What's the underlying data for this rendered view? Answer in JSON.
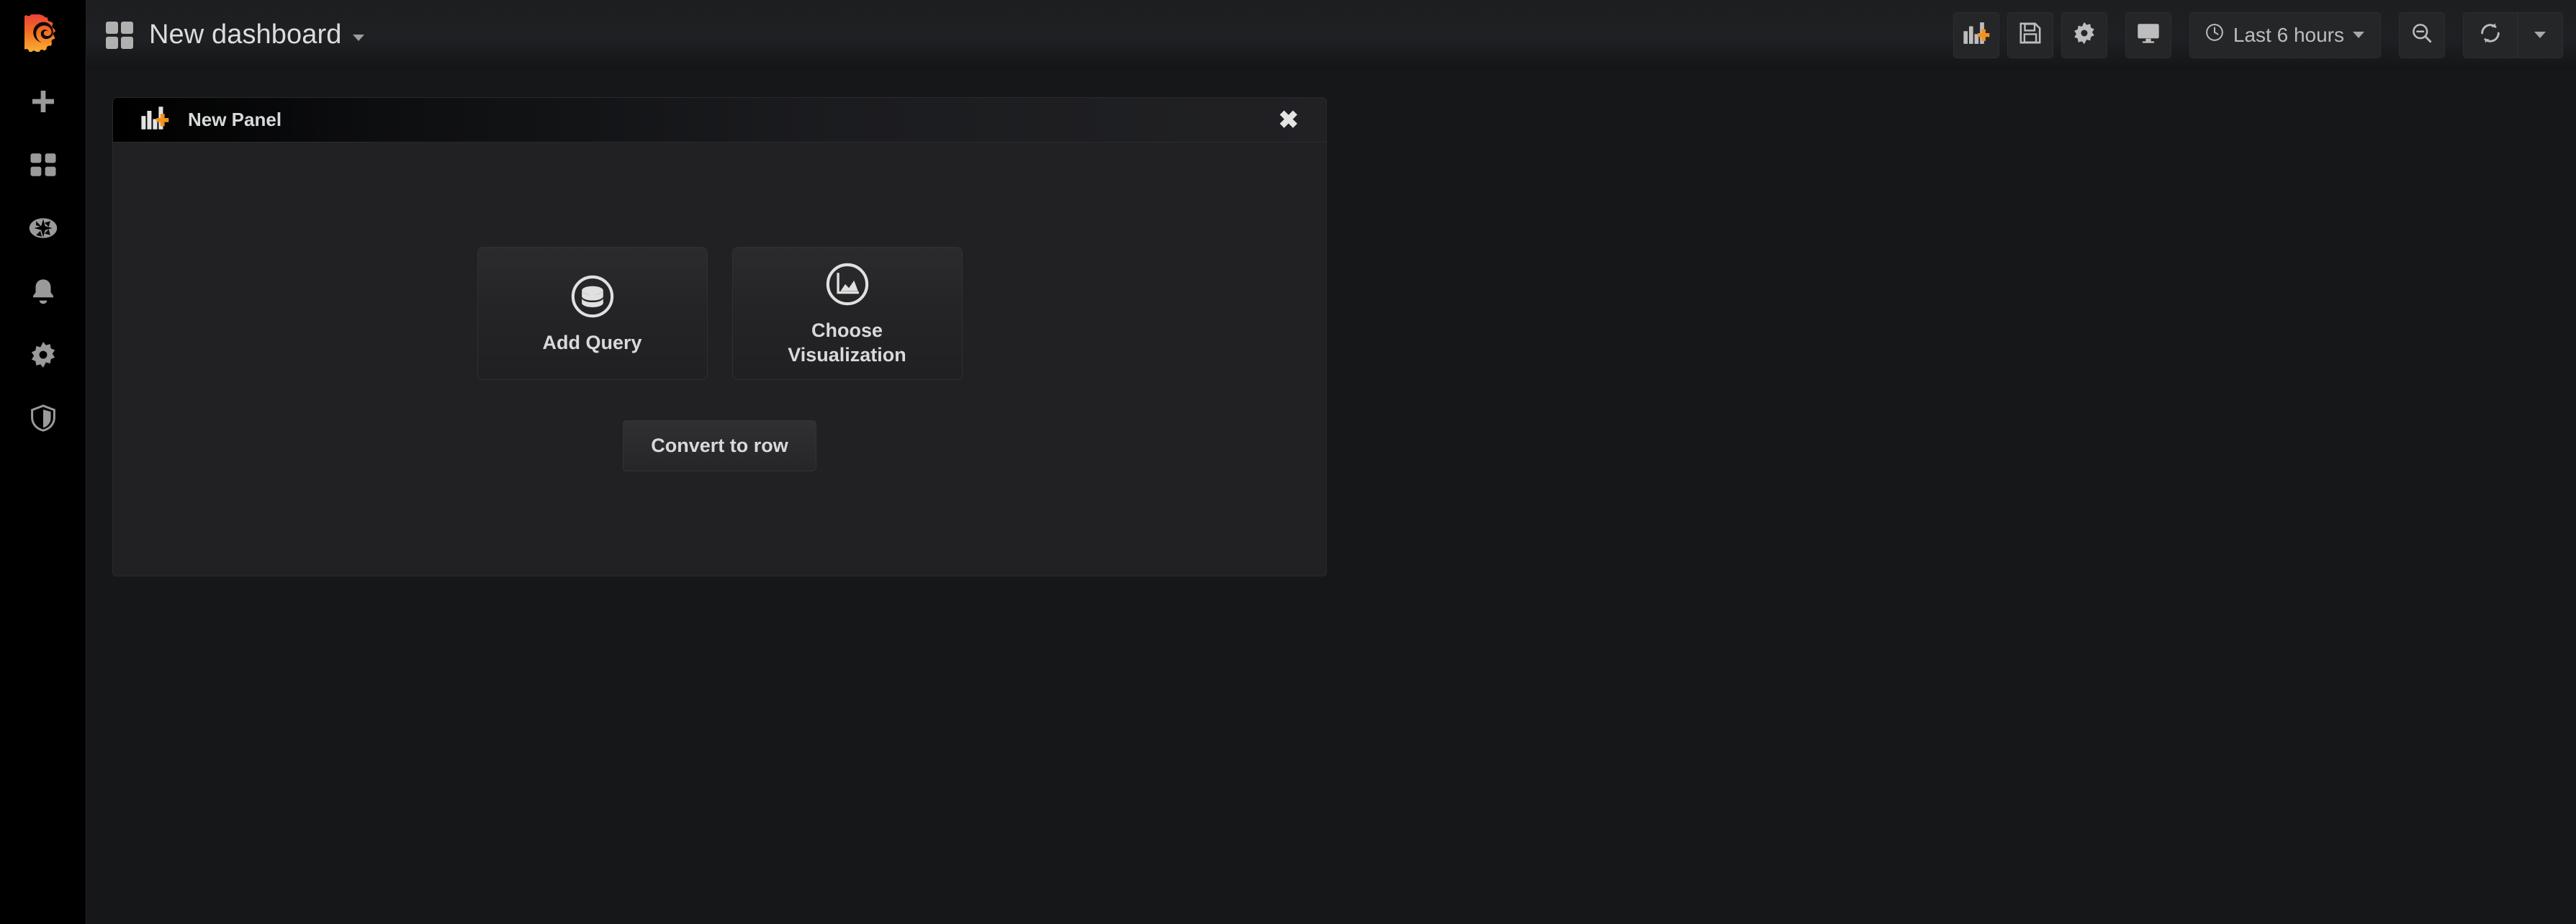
{
  "app": {
    "logo_icon": "grafana-logo-icon",
    "brand_orange": "#f59e3c",
    "brand_red": "#e8543c",
    "bg": "#161719",
    "panel_bg": "#212124"
  },
  "sidebar": {
    "items": [
      {
        "name": "create",
        "icon": "plus-icon",
        "label": "Create"
      },
      {
        "name": "dashboards",
        "icon": "dashboards-grid-icon",
        "label": "Dashboards"
      },
      {
        "name": "explore",
        "icon": "compass-icon",
        "label": "Explore"
      },
      {
        "name": "alerting",
        "icon": "bell-icon",
        "label": "Alerting"
      },
      {
        "name": "configuration",
        "icon": "gear-icon",
        "label": "Configuration"
      },
      {
        "name": "server-admin",
        "icon": "shield-icon",
        "label": "Server Admin"
      }
    ]
  },
  "topnav": {
    "dashboard_icon": "dashboards-grid-icon",
    "title": "New dashboard",
    "title_caret": "chevron-down-icon",
    "actions": [
      {
        "name": "add-panel",
        "icon": "add-panel-icon"
      },
      {
        "name": "save-dashboard",
        "icon": "save-floppy-icon"
      },
      {
        "name": "dashboard-settings",
        "icon": "gear-icon"
      },
      {
        "name": "tv-mode",
        "icon": "monitor-icon"
      }
    ],
    "timepicker": {
      "icon": "clock-icon",
      "value": "Last 6 hours",
      "caret": "chevron-down-icon"
    },
    "zoom_out": {
      "name": "zoom-out",
      "icon": "magnifier-minus-icon"
    },
    "refresh": {
      "name": "refresh",
      "icon": "refresh-circular-arrows-icon"
    },
    "refresh_interval": {
      "name": "refresh-interval",
      "icon": "chevron-down-icon"
    }
  },
  "panel": {
    "icon": "add-panel-icon",
    "title": "New Panel",
    "close_icon": "✖",
    "cards": [
      {
        "name": "add-query",
        "icon": "database-icon",
        "label": "Add Query"
      },
      {
        "name": "choose-visualization",
        "icon": "area-chart-icon",
        "label": "Choose\nVisualization"
      }
    ],
    "cards_labels": {
      "add_query": "Add Query",
      "choose_visualization_line1": "Choose",
      "choose_visualization_line2": "Visualization"
    },
    "convert_to_row": "Convert to row"
  }
}
